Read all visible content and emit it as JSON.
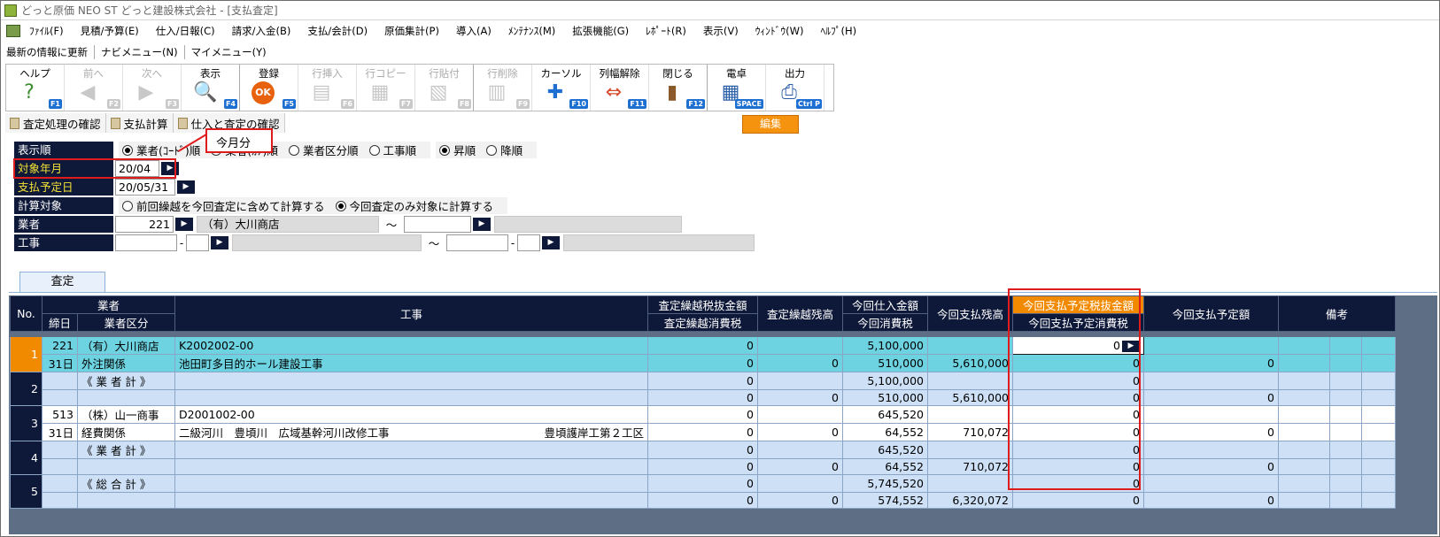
{
  "title": "どっと原価 NEO ST どっと建設株式会社 - [支払査定]",
  "menu": [
    "ﾌｧｲﾙ(F)",
    "見積/予算(E)",
    "仕入/日報(C)",
    "請求/入金(B)",
    "支払/会計(D)",
    "原価集計(P)",
    "導入(A)",
    "ﾒﾝﾃﾅﾝｽ(M)",
    "拡張機能(G)",
    "ﾚﾎﾟｰﾄ(R)",
    "表示(V)",
    "ｳｨﾝﾄﾞｳ(W)",
    "ﾍﾙﾌﾟ(H)"
  ],
  "quickbar": [
    "最新の情報に更新",
    "ナビメニュー(N)",
    "マイメニュー(Y)"
  ],
  "toolbar": [
    {
      "label": "ヘルプ",
      "key": "F1",
      "icon": "help-icon",
      "enabled": true
    },
    {
      "label": "前へ",
      "key": "F2",
      "icon": "arrow-left-icon",
      "enabled": false
    },
    {
      "label": "次へ",
      "key": "F3",
      "icon": "arrow-right-icon",
      "enabled": false
    },
    {
      "label": "表示",
      "key": "F4",
      "icon": "search-icon",
      "enabled": true
    },
    {
      "label": "登録",
      "key": "F5",
      "icon": "ok-icon",
      "enabled": true
    },
    {
      "label": "行挿入",
      "key": "F6",
      "icon": "row-insert-icon",
      "enabled": false
    },
    {
      "label": "行コピー",
      "key": "F7",
      "icon": "row-copy-icon",
      "enabled": false
    },
    {
      "label": "行貼付",
      "key": "F8",
      "icon": "row-paste-icon",
      "enabled": false
    },
    {
      "label": "行削除",
      "key": "F9",
      "icon": "row-delete-icon",
      "enabled": false
    },
    {
      "label": "カーソル",
      "key": "F10",
      "icon": "cursor-icon",
      "enabled": true
    },
    {
      "label": "列幅解除",
      "key": "F11",
      "icon": "column-width-icon",
      "enabled": true
    },
    {
      "label": "閉じる",
      "key": "F12",
      "icon": "door-icon",
      "enabled": true
    },
    {
      "label": "電卓",
      "key": "SPACE",
      "icon": "calculator-icon",
      "enabled": true
    },
    {
      "label": "出力",
      "key": "Ctrl P",
      "icon": "printer-icon",
      "enabled": true
    }
  ],
  "mode_badge": "編集",
  "subtabs": [
    "査定処理の確認",
    "支払計算",
    "仕入と査定の確認"
  ],
  "callout": "今月分",
  "form": {
    "order_label": "表示順",
    "order_options": [
      "業者(ｺｰﾄﾞ)順",
      "業者(ｶﾅ)順",
      "業者区分順",
      "工事順"
    ],
    "sort_options": [
      "昇順",
      "降順"
    ],
    "month_label": "対象年月",
    "month_value": "20/04",
    "paydate_label": "支払予定日",
    "paydate_value": "20/05/31",
    "calc_label": "計算対象",
    "calc_options": [
      "前回繰越を今回査定に含めて計算する",
      "今回査定のみ対象に計算する"
    ],
    "vendor_label": "業者",
    "vendor_code": "221",
    "vendor_name": "（有）大川商店",
    "range_sep": "～",
    "project_label": "工事",
    "dash": "-"
  },
  "tab_label": "査定",
  "headers": {
    "no": "No.",
    "vendor": "業者",
    "close_day": "締日",
    "vendor_class": "業者区分",
    "project": "工事",
    "carry_net": "査定繰越税抜金額",
    "carry_tax": "査定繰越消費税",
    "carry_balance": "査定繰越残高",
    "purchase_amount": "今回仕入金額",
    "purchase_tax": "今回消費税",
    "pay_balance": "今回支払残高",
    "sched_net": "今回支払予定税抜金額",
    "sched_tax": "今回支払予定消費税",
    "sched_amount": "今回支払予定額",
    "remarks": "備考"
  },
  "rows": [
    {
      "no": "1",
      "a1": "221",
      "a2": "（有）大川商店",
      "p1": "K2002002-00",
      "b1": "31日",
      "b2": "外注関係",
      "p2": "池田町多目的ホール建設工事",
      "p2r": "",
      "c1": "0",
      "c2": "0",
      "d2": "0",
      "e1": "5,100,000",
      "e2": "510,000",
      "f2": "5,610,000",
      "g1": "0",
      "g2": "0",
      "h2": "0",
      "style": "cyan"
    },
    {
      "no": "2",
      "a1": "",
      "a2": "《 業 者 計 》",
      "p1": "",
      "b1": "",
      "b2": "",
      "p2": "",
      "p2r": "",
      "c1": "0",
      "c2": "0",
      "d2": "0",
      "e1": "5,100,000",
      "e2": "510,000",
      "f2": "5,610,000",
      "g1": "0",
      "g2": "0",
      "h2": "0",
      "style": "blue"
    },
    {
      "no": "3",
      "a1": "513",
      "a2": "（株）山一商事",
      "p1": "D2001002-00",
      "b1": "31日",
      "b2": "経費関係",
      "p2": "二級河川　豊頃川　広域基幹河川改修工事",
      "p2r": "豊頃護岸工第２工区",
      "c1": "0",
      "c2": "0",
      "d2": "0",
      "e1": "645,520",
      "e2": "64,552",
      "f2": "710,072",
      "g1": "0",
      "g2": "0",
      "h2": "0",
      "style": "white"
    },
    {
      "no": "4",
      "a1": "",
      "a2": "《 業 者 計 》",
      "p1": "",
      "b1": "",
      "b2": "",
      "p2": "",
      "p2r": "",
      "c1": "0",
      "c2": "0",
      "d2": "0",
      "e1": "645,520",
      "e2": "64,552",
      "f2": "710,072",
      "g1": "0",
      "g2": "0",
      "h2": "0",
      "style": "blue"
    },
    {
      "no": "5",
      "a1": "",
      "a2": "《 総 合 計 》",
      "p1": "",
      "b1": "",
      "b2": "",
      "p2": "",
      "p2r": "",
      "c1": "0",
      "c2": "0",
      "d2": "0",
      "e1": "5,745,520",
      "e2": "574,552",
      "f2": "6,320,072",
      "g1": "0",
      "g2": "0",
      "h2": "0",
      "style": "blue"
    }
  ]
}
